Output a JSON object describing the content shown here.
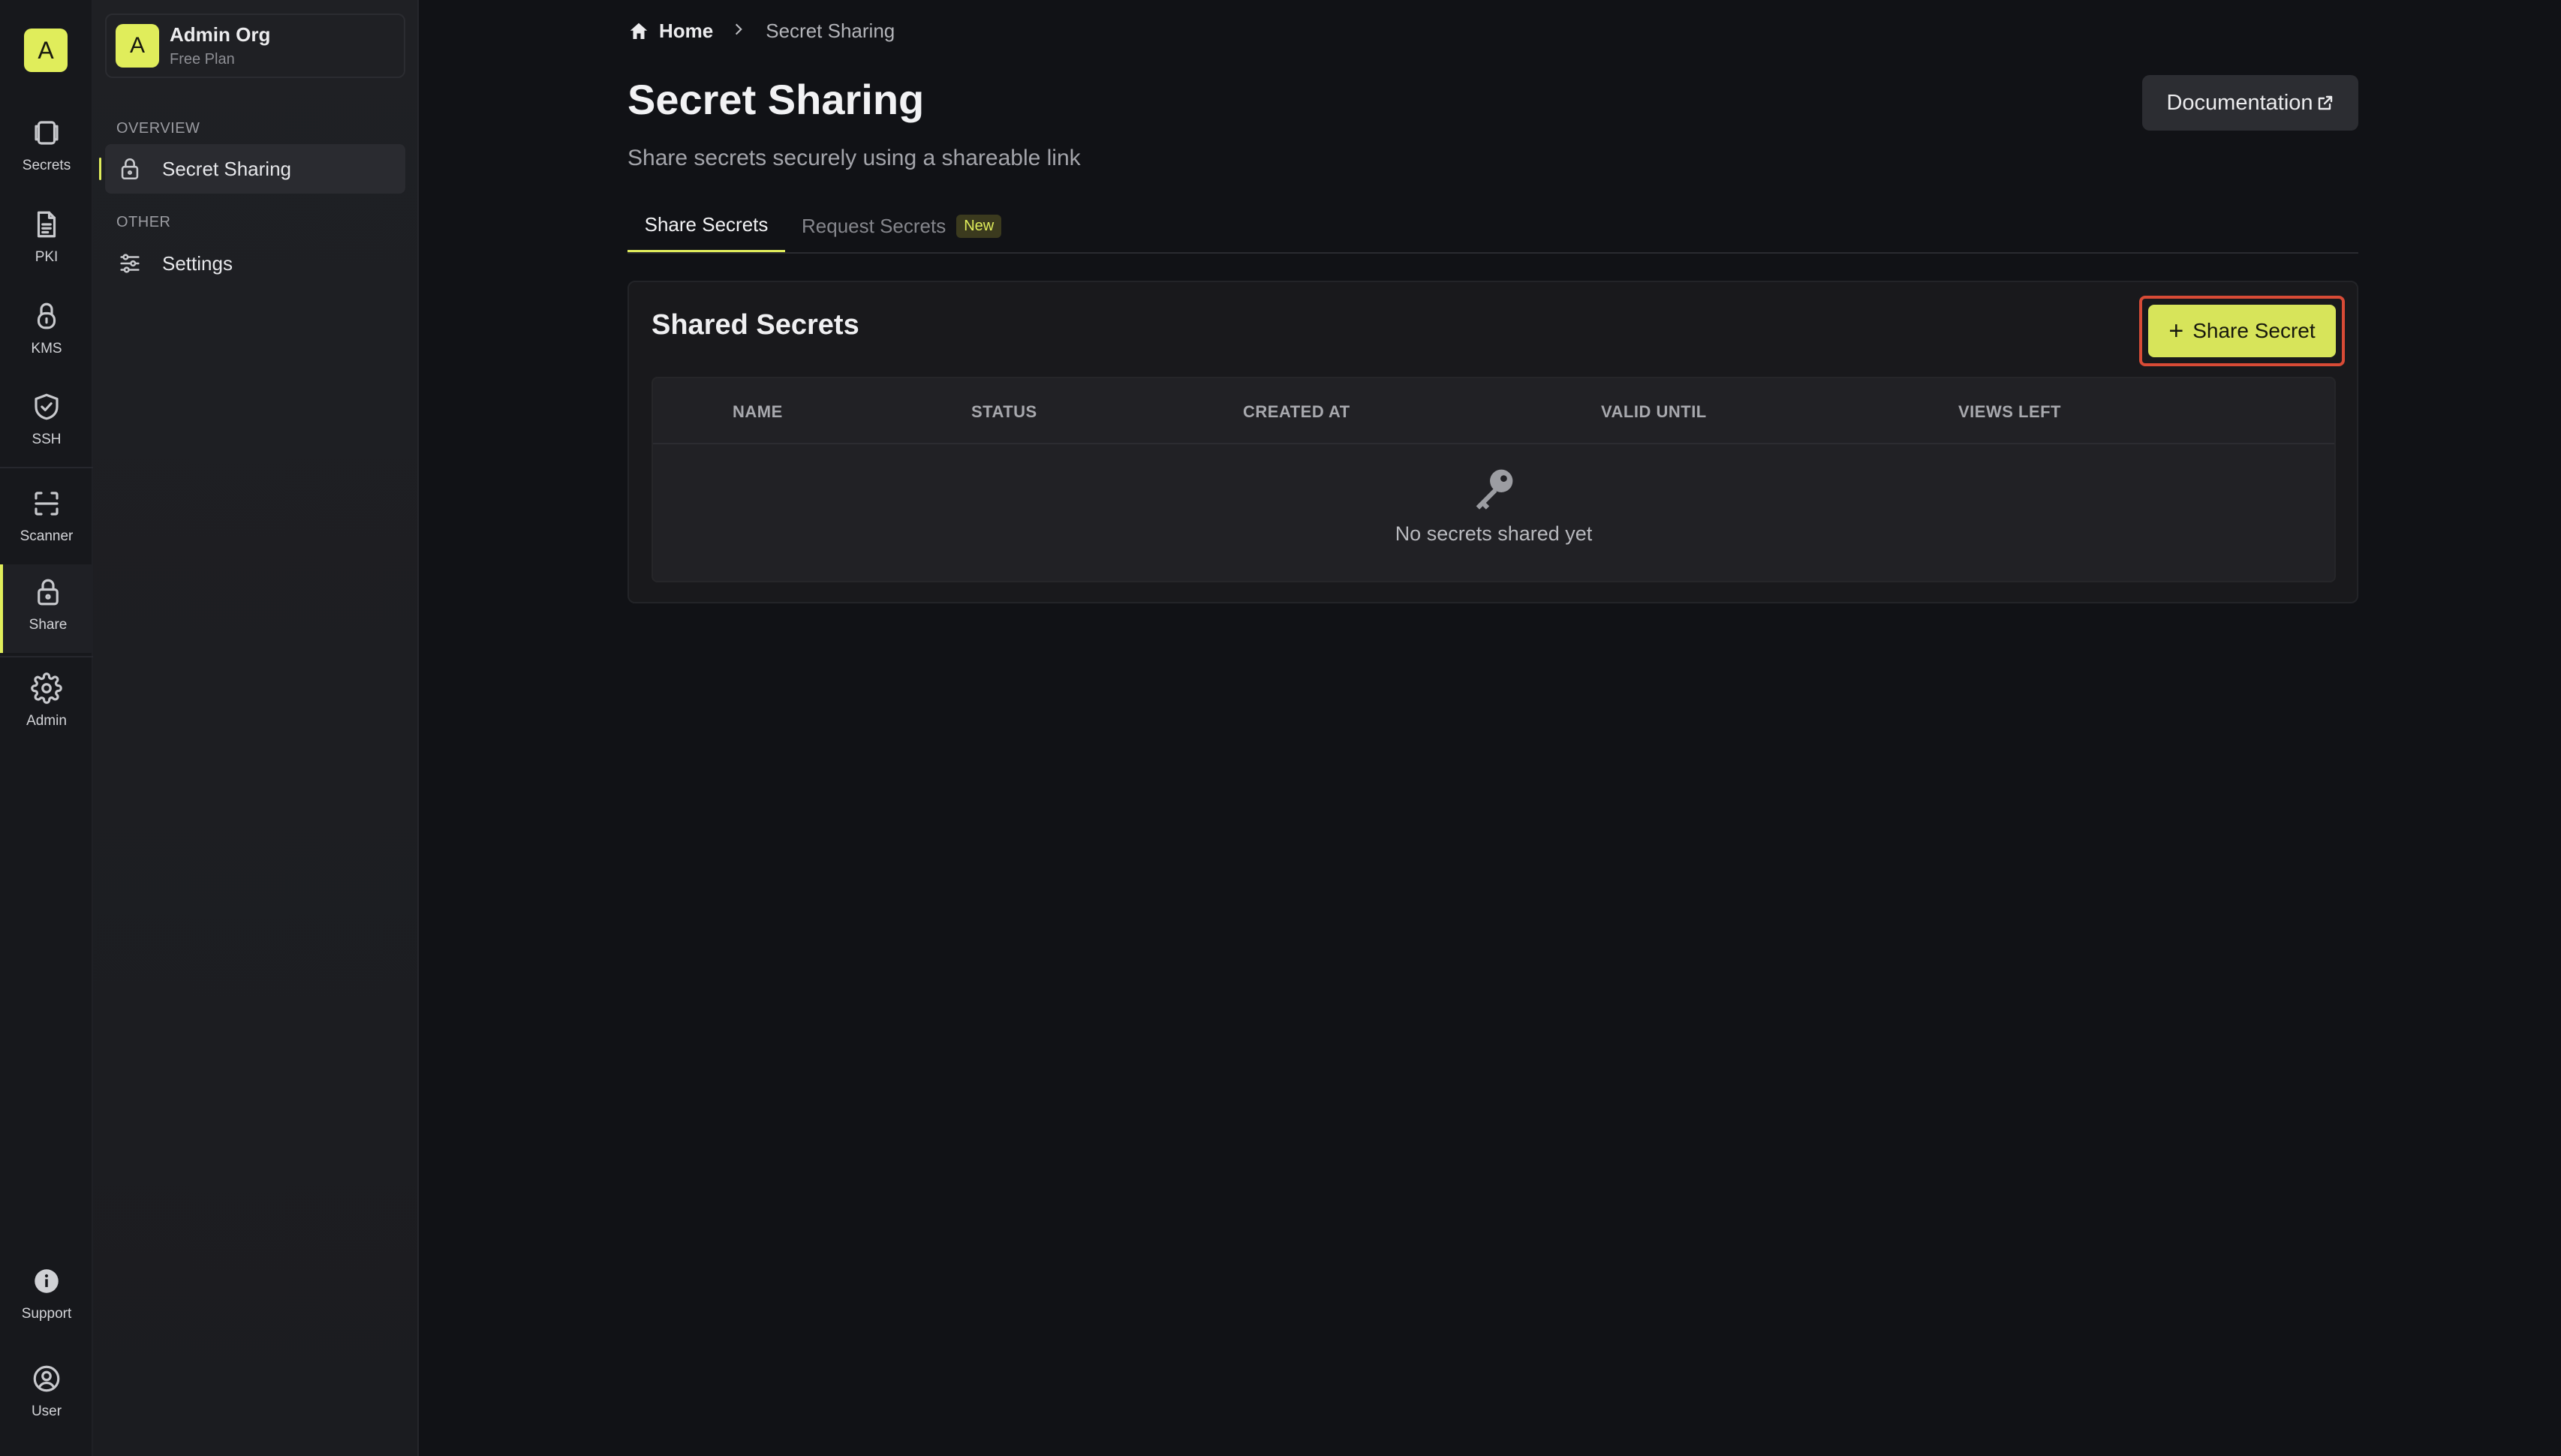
{
  "rail": {
    "logo_letter": "A",
    "items": [
      {
        "label": "Secrets",
        "icon": "secrets-icon"
      },
      {
        "label": "PKI",
        "icon": "document-icon"
      },
      {
        "label": "KMS",
        "icon": "lock-icon"
      },
      {
        "label": "SSH",
        "icon": "shield-icon"
      },
      {
        "label": "Scanner",
        "icon": "scanner-icon"
      },
      {
        "label": "Share",
        "icon": "lock-icon",
        "active": true
      },
      {
        "label": "Admin",
        "icon": "gear-icon"
      },
      {
        "label": "Support",
        "icon": "info-icon"
      },
      {
        "label": "User",
        "icon": "user-icon"
      }
    ]
  },
  "sidebar": {
    "org": {
      "avatar_letter": "A",
      "name": "Admin Org",
      "plan": "Free Plan"
    },
    "sections": [
      {
        "title": "OVERVIEW",
        "items": [
          {
            "label": "Secret Sharing",
            "icon": "lock-icon",
            "active": true
          }
        ]
      },
      {
        "title": "OTHER",
        "items": [
          {
            "label": "Settings",
            "icon": "sliders-icon"
          }
        ]
      }
    ]
  },
  "breadcrumb": {
    "home": "Home",
    "current": "Secret Sharing"
  },
  "header": {
    "title": "Secret Sharing",
    "subtitle": "Share secrets securely using a shareable link",
    "documentation_label": "Documentation"
  },
  "tabs": [
    {
      "label": "Share Secrets",
      "active": true
    },
    {
      "label": "Request Secrets",
      "badge": "New"
    }
  ],
  "card": {
    "title": "Shared Secrets",
    "share_button_label": "Share Secret",
    "columns": [
      "NAME",
      "STATUS",
      "CREATED AT",
      "VALID UNTIL",
      "VIEWS LEFT"
    ],
    "empty_text": "No secrets shared yet"
  },
  "colors": {
    "accent": "#e0ed5b",
    "highlight": "#d84b36",
    "background": "#111216"
  }
}
